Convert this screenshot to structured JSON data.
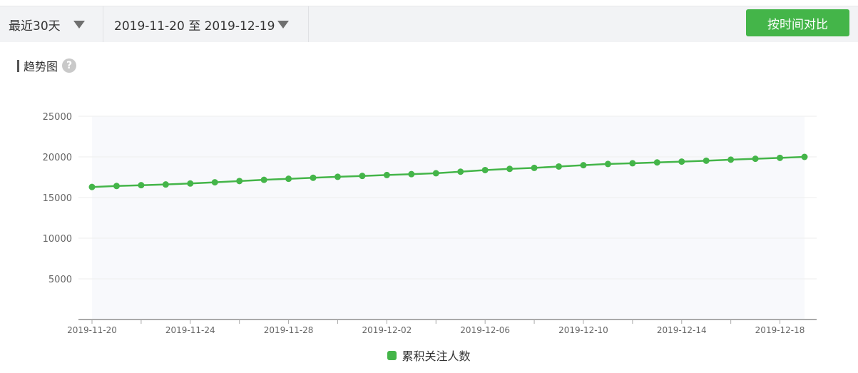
{
  "toolbar": {
    "range_value": "最近30天",
    "date_range_value": "2019-11-20 至 2019-12-19",
    "compare_label": "按时间对比"
  },
  "section": {
    "title": "趋势图",
    "help_symbol": "?"
  },
  "colors": {
    "accent": "#44b549",
    "grid": "#eeeeee",
    "plot_bg": "#f8f9fc"
  },
  "chart_data": {
    "type": "line",
    "title": "",
    "xlabel": "",
    "ylabel": "",
    "ylim": [
      0,
      25000
    ],
    "yticks": [
      5000,
      10000,
      15000,
      20000,
      25000
    ],
    "xticklabels": [
      "2019-11-20",
      "2019-11-24",
      "2019-11-28",
      "2019-12-02",
      "2019-12-06",
      "2019-12-10",
      "2019-12-14",
      "2019-12-18"
    ],
    "x": [
      "2019-11-20",
      "2019-11-21",
      "2019-11-22",
      "2019-11-23",
      "2019-11-24",
      "2019-11-25",
      "2019-11-26",
      "2019-11-27",
      "2019-11-28",
      "2019-11-29",
      "2019-11-30",
      "2019-12-01",
      "2019-12-02",
      "2019-12-03",
      "2019-12-04",
      "2019-12-05",
      "2019-12-06",
      "2019-12-07",
      "2019-12-08",
      "2019-12-09",
      "2019-12-10",
      "2019-12-11",
      "2019-12-12",
      "2019-12-13",
      "2019-12-14",
      "2019-12-15",
      "2019-12-16",
      "2019-12-17",
      "2019-12-18",
      "2019-12-19"
    ],
    "series": [
      {
        "name": "累积关注人数",
        "values": [
          16300,
          16420,
          16520,
          16610,
          16730,
          16880,
          17030,
          17180,
          17310,
          17430,
          17550,
          17660,
          17770,
          17880,
          17990,
          18180,
          18380,
          18530,
          18650,
          18820,
          18980,
          19130,
          19220,
          19320,
          19420,
          19530,
          19660,
          19770,
          19880,
          20000
        ]
      }
    ],
    "grid": true,
    "legend_position": "bottom-center"
  }
}
